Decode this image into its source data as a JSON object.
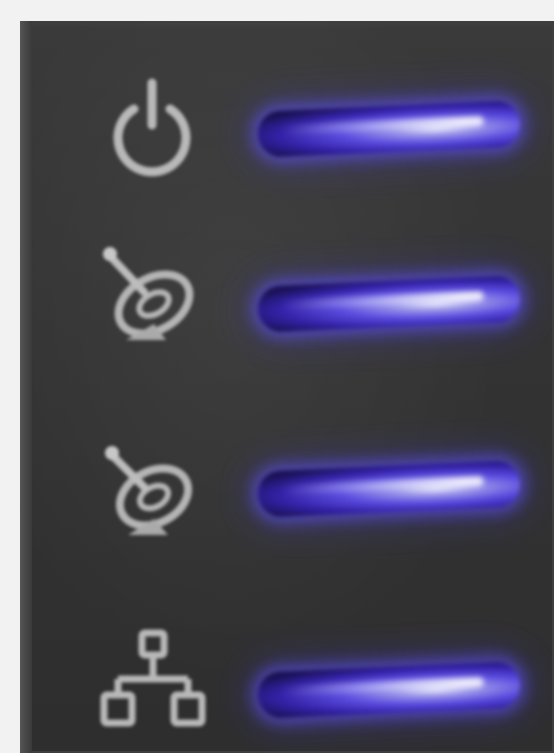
{
  "indicators": [
    {
      "icon": "power-icon",
      "led_color": "#5a48f0",
      "state": "on"
    },
    {
      "icon": "satellite-dish-icon",
      "led_color": "#5a48f0",
      "state": "on"
    },
    {
      "icon": "satellite-dish-icon",
      "led_color": "#5a48f0",
      "state": "on"
    },
    {
      "icon": "network-icon",
      "led_color": "#5a48f0",
      "state": "on"
    }
  ]
}
